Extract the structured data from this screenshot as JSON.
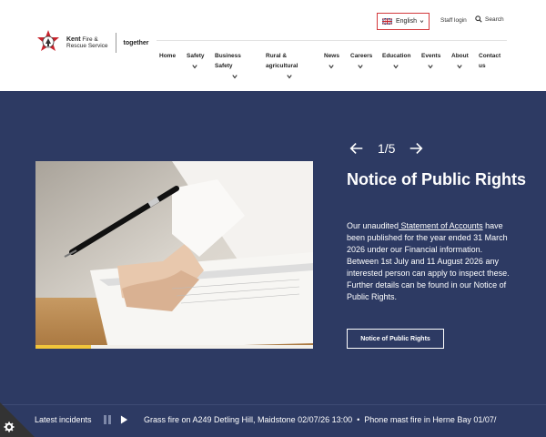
{
  "brand": {
    "name_bold": "Kent",
    "name_rest": "Fire &",
    "name_line2": "Rescue Service",
    "tagline": "together"
  },
  "utility": {
    "language": "English",
    "staff_login": "Staff login",
    "search": "Search"
  },
  "nav": {
    "items": [
      {
        "label": "Home"
      },
      {
        "label": "Safety"
      },
      {
        "label": "Business Safety"
      },
      {
        "label": "Rural & agricultural"
      },
      {
        "label": "News"
      },
      {
        "label": "Careers"
      },
      {
        "label": "Education"
      },
      {
        "label": "Events"
      },
      {
        "label": "About"
      },
      {
        "label": "Contact us"
      }
    ]
  },
  "slider": {
    "counter": "1/5",
    "title": "Notice of Public Rights",
    "body_prefix": "Our unaudited",
    "body_link": " Statement of Accounts",
    "body_suffix": " have been published for the year ended 31 March 2026 under our Financial information. Between 1st July and 11 August 2026 any interested person can apply to inspect these. Further details can be found in our Notice of Public Rights.",
    "button": "Notice of Public Rights",
    "progress": 0.2
  },
  "incidents": {
    "label": "Latest incidents",
    "items": [
      "Grass fire on A249 Detling Hill, Maidstone 02/07/26 13:00",
      "•",
      "Phone mast fire in Herne Bay 01/07/"
    ]
  },
  "colors": {
    "navy": "#2d3a63",
    "accent_red": "#d3393c",
    "progress_yellow": "#f1c53a"
  }
}
